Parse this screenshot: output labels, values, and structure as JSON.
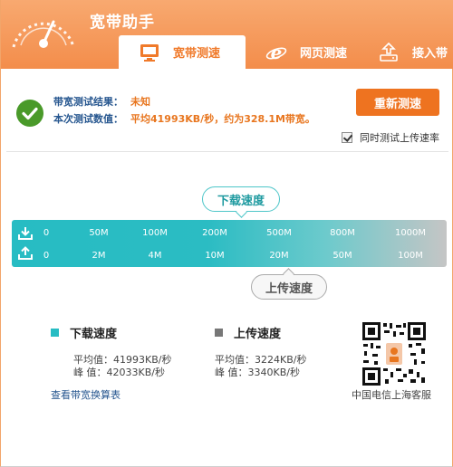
{
  "app": {
    "title": "宽带助手"
  },
  "tabs": [
    {
      "label": "宽带测速",
      "active": true,
      "icon": "monitor-icon"
    },
    {
      "label": "网页测速",
      "active": false,
      "icon": "ie-browser-icon"
    },
    {
      "label": "接入带",
      "active": false,
      "icon": "router-upload-icon"
    }
  ],
  "result": {
    "status_label": "带宽测试结果：",
    "status_value": "未知",
    "value_label": "本次测试数值：",
    "value_text": "平均41993KB/秒，约为328.1M带宽。",
    "retest_label": "重新测速",
    "upload_checkbox_label": "同时测试上传速率",
    "upload_checkbox_checked": true
  },
  "speedbar": {
    "download_label": "下载速度",
    "upload_label": "上传速度",
    "download_ticks": [
      "0",
      "50M",
      "100M",
      "200M",
      "500M",
      "800M",
      "1000M"
    ],
    "upload_ticks": [
      "0",
      "2M",
      "4M",
      "10M",
      "20M",
      "50M",
      "100M"
    ]
  },
  "stats": {
    "download": {
      "title": "下载速度",
      "avg": "平均值：41993KB/秒",
      "peak": "峰  值：42033KB/秒",
      "color": "#27bcc3"
    },
    "upload": {
      "title": "上传速度",
      "avg": "平均值：3224KB/秒",
      "peak": "峰  值：3340KB/秒",
      "color": "#777777"
    },
    "conversion_link": "查看带宽换算表",
    "qr_caption": "中国电信上海客服"
  },
  "colors": {
    "accent": "#f38d4b",
    "button": "#ee7320",
    "teal": "#27bcc3",
    "link": "#26568f"
  }
}
